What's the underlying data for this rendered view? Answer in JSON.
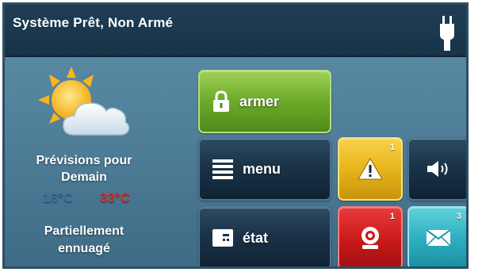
{
  "header": {
    "status": "Système Prêt, Non Armé",
    "power_icon": "plug-icon"
  },
  "weather": {
    "forecast_line1": "Prévisions pour",
    "forecast_line2": "Demain",
    "temp_low": "16°C",
    "temp_high": "33°C",
    "condition_line1": "Partiellement",
    "condition_line2": "ennuagé",
    "icon": "partly-cloudy-icon"
  },
  "buttons": {
    "arm": {
      "label": "armer",
      "icon": "lock-icon"
    },
    "menu": {
      "label": "menu",
      "icon": "menu-list-icon"
    },
    "status": {
      "label": "état",
      "icon": "panel-icon"
    },
    "alerts": {
      "badge": "1",
      "icon": "warning-icon"
    },
    "volume": {
      "icon": "speaker-icon"
    },
    "alarm": {
      "badge": "1",
      "icon": "siren-icon"
    },
    "messages": {
      "badge": "3",
      "icon": "envelope-icon"
    }
  },
  "colors": {
    "arm": "#6fae2c",
    "alert": "#e7b51c",
    "alarm": "#c81a1a",
    "messages": "#2fb0c0",
    "temp_low": "#3f6fa0",
    "temp_high": "#e02a2a"
  }
}
